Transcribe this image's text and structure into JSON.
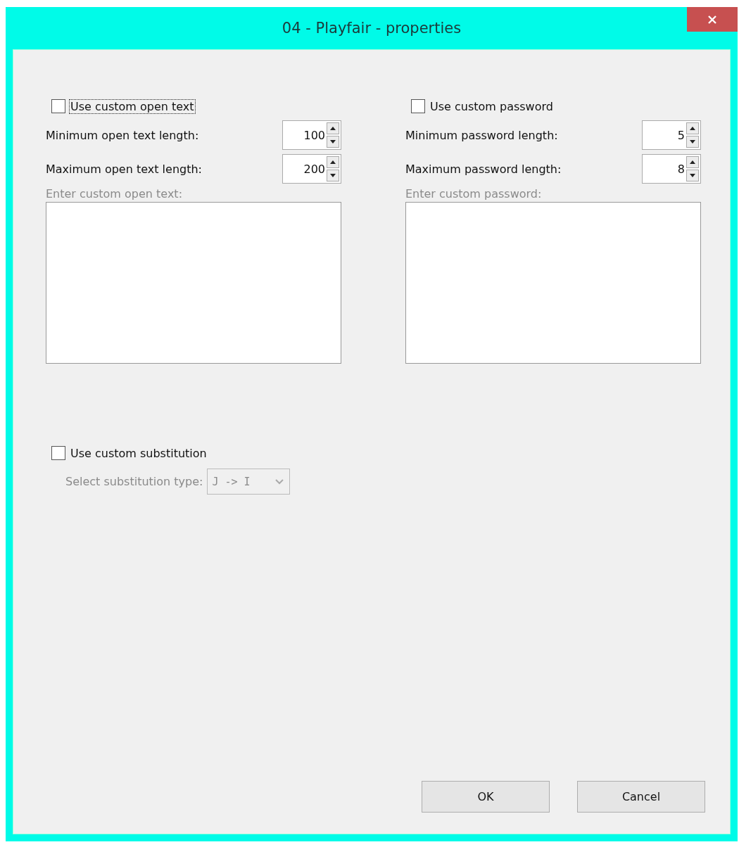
{
  "window": {
    "title": "04 - Playfair - properties"
  },
  "sections": [
    {
      "checkbox": {
        "label": "Use custom open text",
        "checked": false,
        "focused": true
      },
      "spinners": [
        {
          "label": "Minimum open text length:",
          "value": "100"
        },
        {
          "label": "Maximum open text length:",
          "value": "200"
        }
      ],
      "text_area": {
        "label": "Enter custom open text:",
        "disabled": true
      }
    },
    {
      "checkbox": {
        "label": "Use custom password",
        "checked": false,
        "focused": false
      },
      "spinners": [
        {
          "label": "Minimum password length:",
          "value": "5"
        },
        {
          "label": "Maximum password length:",
          "value": "8"
        }
      ],
      "text_area": {
        "label": "Enter custom password:",
        "disabled": true
      }
    }
  ],
  "substitution": {
    "checkbox": {
      "label": "Use custom substitution",
      "checked": false,
      "focused": false
    },
    "select": {
      "label": "Select substitution type:",
      "value": "J -> I",
      "disabled": true
    }
  },
  "buttons": [
    {
      "label": "OK"
    },
    {
      "label": "Cancel"
    }
  ]
}
